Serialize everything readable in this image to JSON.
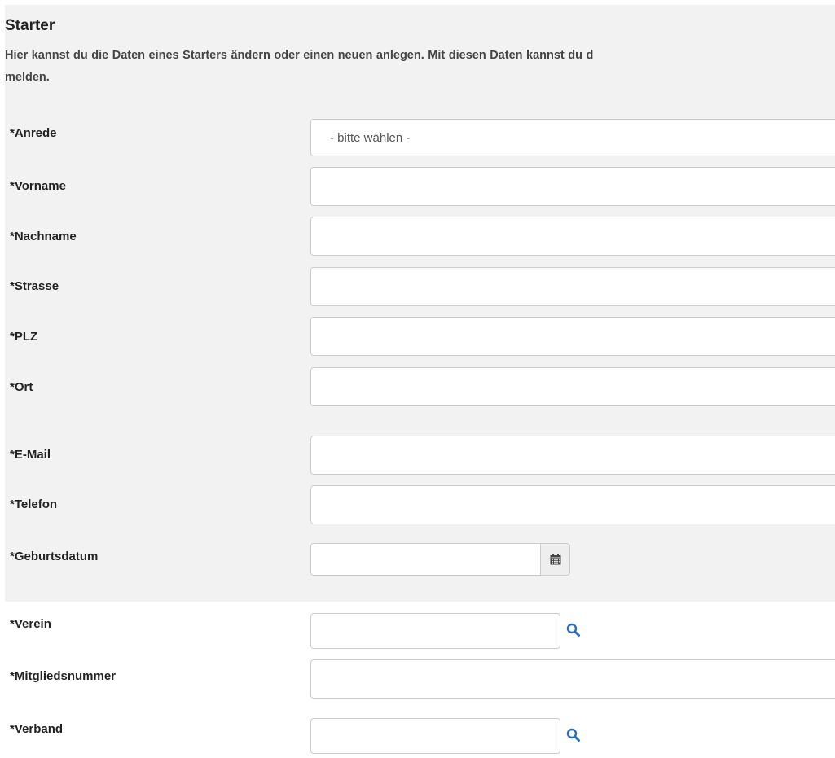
{
  "header": {
    "title": "Starter",
    "description_line1": "Hier kannst du die Daten eines Starters ändern oder einen neuen anlegen. Mit diesen Daten kannst du d",
    "description_line2": "melden."
  },
  "form": {
    "anrede": {
      "label": "*Anrede",
      "selected": "- bitte wählen -"
    },
    "vorname": {
      "label": "*Vorname",
      "value": ""
    },
    "nachname": {
      "label": "*Nachname",
      "value": ""
    },
    "strasse": {
      "label": "*Strasse",
      "value": ""
    },
    "plz": {
      "label": "*PLZ",
      "value": ""
    },
    "ort": {
      "label": "*Ort",
      "value": ""
    },
    "email": {
      "label": "*E-Mail",
      "value": ""
    },
    "telefon": {
      "label": "*Telefon",
      "value": ""
    },
    "geburtsdatum": {
      "label": "*Geburtsdatum",
      "value": "",
      "button_icon": "calendar-icon"
    },
    "verein": {
      "label": "*Verein",
      "value": "",
      "button_icon": "search-icon"
    },
    "mitgliedsnummer": {
      "label": "*Mitgliedsnummer",
      "value": ""
    },
    "verband": {
      "label": "*Verband",
      "value": "",
      "button_icon": "search-icon"
    }
  },
  "colors": {
    "panel_background": "#f2f2f2",
    "search_icon": "#2a6ebb"
  }
}
